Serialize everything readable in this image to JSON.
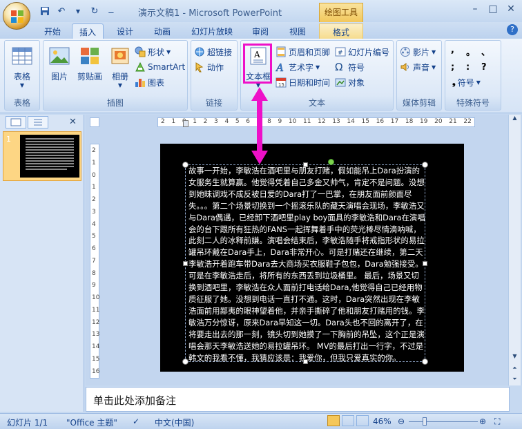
{
  "window": {
    "title": "演示文稿1 - Microsoft PowerPoint",
    "context_tab_group": "绘图工具",
    "minimize": "–",
    "maximize": "□",
    "close": "✕"
  },
  "tabs": [
    "开始",
    "插入",
    "设计",
    "动画",
    "幻灯片放映",
    "审阅",
    "视图",
    "格式"
  ],
  "active_tab": "插入",
  "ribbon": {
    "groups": {
      "tables": {
        "label": "表格",
        "table": "表格"
      },
      "illustrations": {
        "label": "插图",
        "picture": "图片",
        "clipart": "剪贴画",
        "album": "相册",
        "shapes": "形状",
        "smartart": "SmartArt",
        "chart": "图表"
      },
      "links": {
        "label": "链接",
        "hyperlink": "超链接",
        "action": "动作"
      },
      "text": {
        "label": "文本",
        "textbox": "文本框",
        "header_footer": "页眉和页脚",
        "wordart": "艺术字",
        "datetime": "日期和时间",
        "slide_number": "幻灯片编号",
        "symbol": "符号",
        "object": "对象"
      },
      "media": {
        "label": "媒体剪辑",
        "movie": "影片",
        "sound": "声音"
      },
      "special": {
        "label": "特殊符号",
        "symbol": "符号",
        "chars": [
          ",",
          "。",
          "、",
          ";",
          ":",
          "?"
        ]
      }
    }
  },
  "left_panel": {
    "slide_number": "1"
  },
  "slide": {
    "text": "故事一开始，李敏浩在酒吧里与朋友打赌，假如能吊上Dara扮演的女服务生就算赢。他觉得凭着自己多金又帅气，肯定不是问题。没想到她昧调戏不成反被日爱的Dara打了一巴掌，在朋友面前颜面尽失。。。第二个场景切换到一个摇滚乐队的藏天演唱会现场，李敏浩又与Dara偶遇，已经卸下酒吧里play  boy面具的李敏浩和Dara在演唱会的台下跟所有狂热的FANS一起挥舞着手中的荧光棒尽情滴呐喊，此刻二人的冰释前嫌。演唱会结束后，李敏浩随手将戒指形状的易拉罐吊环戴在Dara手上，Dara非常开心。可是打赌还在继续，第二天李敏浩开着跑车带Dara去大商场买衣服鞋子包包，Dara勉强接受。可是在李敏浩走后，将所有的东西丢到垃圾桶里。 最后，场景又切换到酒吧里，李敏浩在众人面前打电话给Dara,他觉得自己已经用物质征服了她。没想到电话一直打不通。这时，Dara突然出现在李敏浩面前用鄙夷的眼神望着他，并亲手撕碎了他和朋友打赌用的钱。李敏浩万分惊讶，原来Dara早知这一切。Dara头也不回的离开了，在将要走出去的那一刻，镜头切到她摸了一下胸前的吊坠，这个正是演唱会那天李敏浩送她的易拉罐吊环。 MV的最后打出一行字，不过是韩文的我看不懂，我猜应该是：我爱你，但我只爱真实的你。"
  },
  "rulers": {
    "h_labels": [
      "2",
      "1",
      "0",
      "1",
      "2",
      "3",
      "4",
      "5",
      "6",
      "7",
      "8",
      "9",
      "10",
      "11",
      "12",
      "13",
      "14",
      "15",
      "16",
      "17",
      "18",
      "19",
      "20",
      "21",
      "22"
    ],
    "v_labels": [
      "2",
      "1",
      "0",
      "1",
      "2",
      "3",
      "4",
      "5",
      "6",
      "7",
      "8",
      "9",
      "10",
      "11",
      "12",
      "13",
      "14",
      "15",
      "16"
    ]
  },
  "notes": {
    "placeholder": "单击此处添加备注"
  },
  "status": {
    "slide": "幻灯片 1/1",
    "theme": "\"Office 主题\"",
    "language": "中文(中国)",
    "zoom": "46%",
    "zoom_fraction": 0.46
  }
}
